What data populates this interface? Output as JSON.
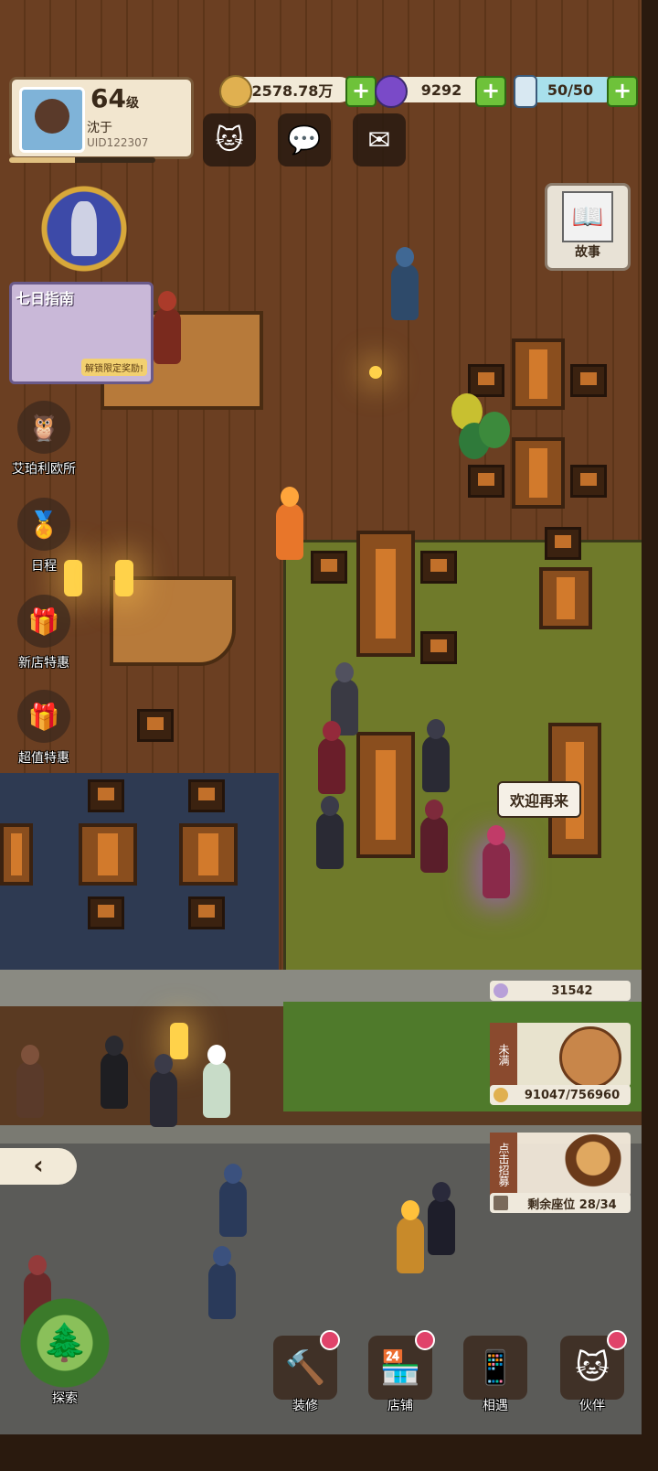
{
  "player": {
    "level": "64",
    "level_suffix": "级",
    "name": "沈于",
    "uid": "UID122307",
    "xp_fraction": 0.45
  },
  "resources": {
    "gold": "2578.78万",
    "gems": "9292",
    "energy": "50/50"
  },
  "top_buttons": [
    "cat-icon",
    "chat-icon",
    "mail-icon"
  ],
  "guide": {
    "title": "七日指南",
    "subtitle": "解锁限定奖励!"
  },
  "left_menu": [
    {
      "label": "艾珀利欧所",
      "icon": "owl-icon"
    },
    {
      "label": "日程",
      "icon": "badge-icon"
    },
    {
      "label": "新店特惠",
      "icon": "gift-icon"
    },
    {
      "label": "超值特惠",
      "icon": "gift-blue-icon"
    }
  ],
  "story": {
    "label": "故事"
  },
  "speech": "欢迎再来",
  "shop_stats": {
    "fans": "31542",
    "piggy_label": "未满",
    "piggy_progress": "91047/756960",
    "recruit_label": "点击招募",
    "seats": "剩余座位 28/34"
  },
  "back": "‹",
  "bottom_nav": [
    {
      "label": "探索",
      "icon": "map-icon",
      "badge": false
    },
    {
      "label": "装修",
      "icon": "hammer-icon",
      "badge": true
    },
    {
      "label": "店铺",
      "icon": "shop-icon",
      "badge": true
    },
    {
      "label": "相遇",
      "icon": "phone-icon",
      "badge": false
    },
    {
      "label": "伙伴",
      "icon": "cat-card-icon",
      "badge": true
    }
  ],
  "colors": {
    "plus": "#6ec23a",
    "badge": "#e0436a"
  }
}
